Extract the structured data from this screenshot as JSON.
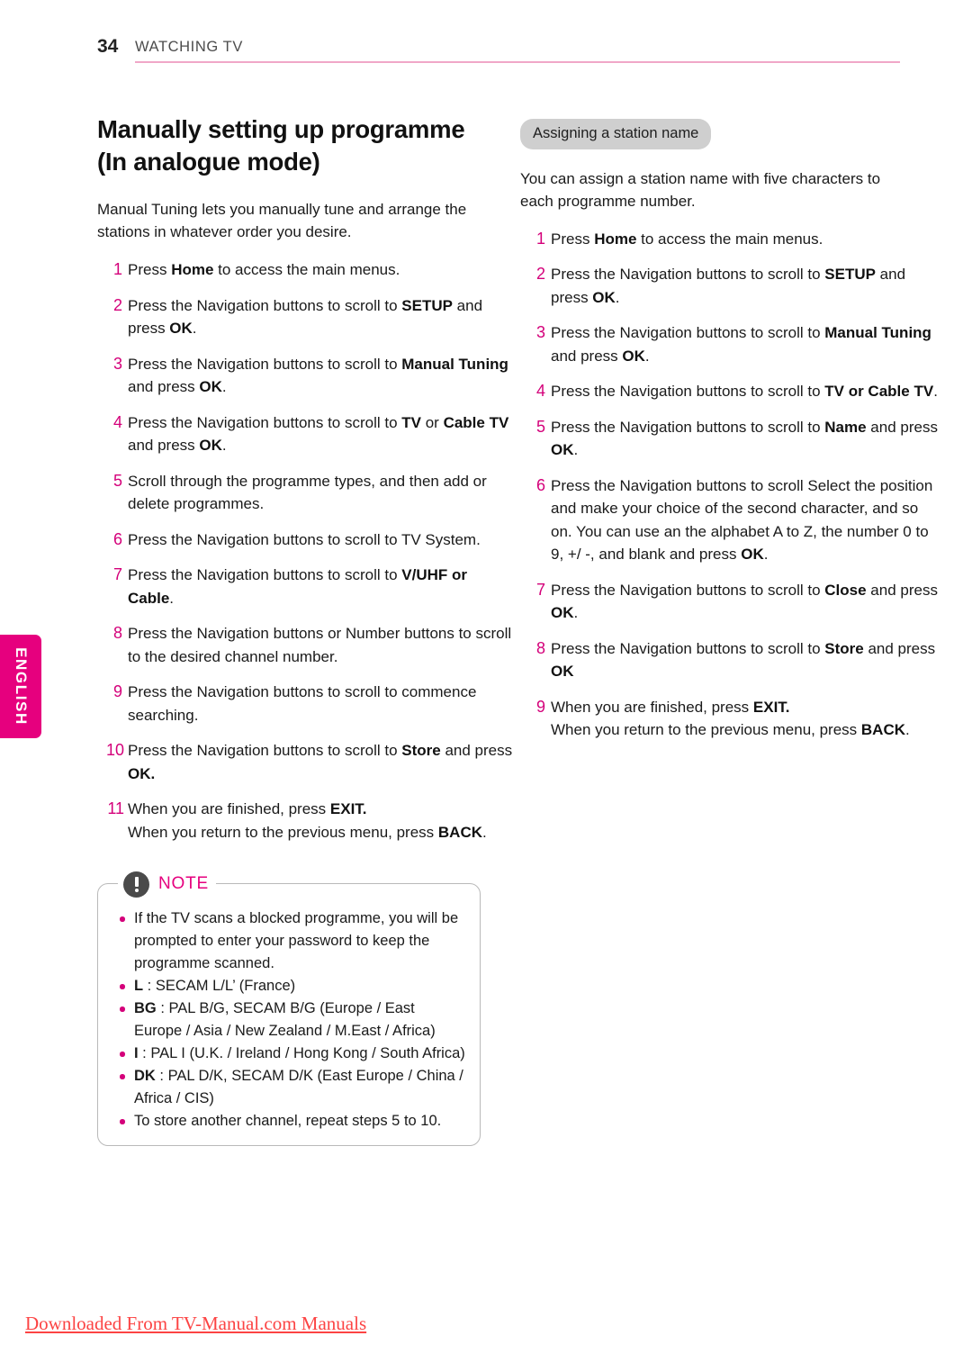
{
  "header": {
    "page_number": "34",
    "chapter": "WATCHING TV",
    "rule_color": "#f0a7c8"
  },
  "side_tab": {
    "label": "ENGLISH",
    "color": "#e6007e"
  },
  "left_column": {
    "title": "Manually setting up programme (In analogue mode)",
    "intro": "Manual Tuning lets you manually tune and arrange the stations in whatever order you desire.",
    "steps": [
      {
        "num": "1",
        "html": "Press <b>Home</b> to access the main menus."
      },
      {
        "num": "2",
        "html": "Press the Navigation buttons to scroll to <b>SETUP</b> and press <b>OK</b>."
      },
      {
        "num": "3",
        "html": "Press the Navigation buttons to scroll to <b>Manual Tuning</b> and press <b>OK</b>."
      },
      {
        "num": "4",
        "html": "Press the Navigation buttons to scroll to <b>TV</b> or <b>Cable TV</b> and press <b>OK</b>."
      },
      {
        "num": "5",
        "html": "Scroll through the programme types, and then add or delete programmes."
      },
      {
        "num": "6",
        "html": "Press the Navigation buttons to scroll to TV System."
      },
      {
        "num": "7",
        "html": "Press the Navigation buttons to scroll to <b>V/UHF or Cable</b>."
      },
      {
        "num": "8",
        "html": "Press the Navigation buttons or Number buttons to scroll to the desired channel number."
      },
      {
        "num": "9",
        "html": "Press the Navigation buttons to scroll to commence searching."
      },
      {
        "num": "10",
        "html": "Press the Navigation buttons to scroll to <b>Store</b> and press <b>OK.</b>"
      },
      {
        "num": "11",
        "html": "When you are finished, press <b>EXIT.</b><br>When you return to the previous menu, press <b>BACK</b>."
      }
    ],
    "note": {
      "title": "NOTE",
      "icon": "exclamation-circle-icon",
      "items": [
        "If the TV scans a blocked programme, you will be prompted to enter your password to keep the programme scanned.",
        "<b>L</b> : SECAM L/L’ (France)",
        "<b>BG</b> : PAL B/G, SECAM B/G (Europe / East Europe / Asia / New Zealand / M.East / Africa)",
        "<b>I</b> : PAL I (U.K. / Ireland / Hong Kong / South Africa)",
        "<b>DK</b> : PAL D/K, SECAM D/K (East Europe / China / Africa / CIS)",
        "To store another channel, repeat steps 5 to 10."
      ]
    }
  },
  "right_column": {
    "tag": "Assigning a station name",
    "intro": "You can assign a station name with five characters to each programme number.",
    "steps": [
      {
        "num": "1",
        "html": "Press <b>Home</b> to access the main menus."
      },
      {
        "num": "2",
        "html": "Press the Navigation buttons to scroll to <b>SETUP</b> and press <b>OK</b>."
      },
      {
        "num": "3",
        "html": "Press the Navigation buttons to scroll to <b>Manual Tuning</b> and press <b>OK</b>."
      },
      {
        "num": "4",
        "html": "Press the Navigation buttons to scroll to <b>TV or Cable TV</b>."
      },
      {
        "num": "5",
        "html": "Press the Navigation buttons to scroll to <b>Name</b> and press <b>OK</b>."
      },
      {
        "num": "6",
        "html": "Press the Navigation buttons to scroll Select the position and make your choice of the second character, and so on. You can use an the alphabet A to Z, the number 0 to 9, +/ -, and blank and press <b>OK</b>."
      },
      {
        "num": "7",
        "html": "Press the Navigation buttons to scroll to <b>Close</b> and press <b>OK</b>."
      },
      {
        "num": "8",
        "html": "Press the Navigation buttons to scroll to <b>Store</b> and press <b>OK</b>"
      },
      {
        "num": "9",
        "html": "When you are finished, press <b>EXIT.</b><br>When you return to the previous menu, press <b>BACK</b>."
      }
    ]
  },
  "footer": {
    "text": "Downloaded From TV-Manual.com Manuals",
    "color": "#fc4444"
  }
}
